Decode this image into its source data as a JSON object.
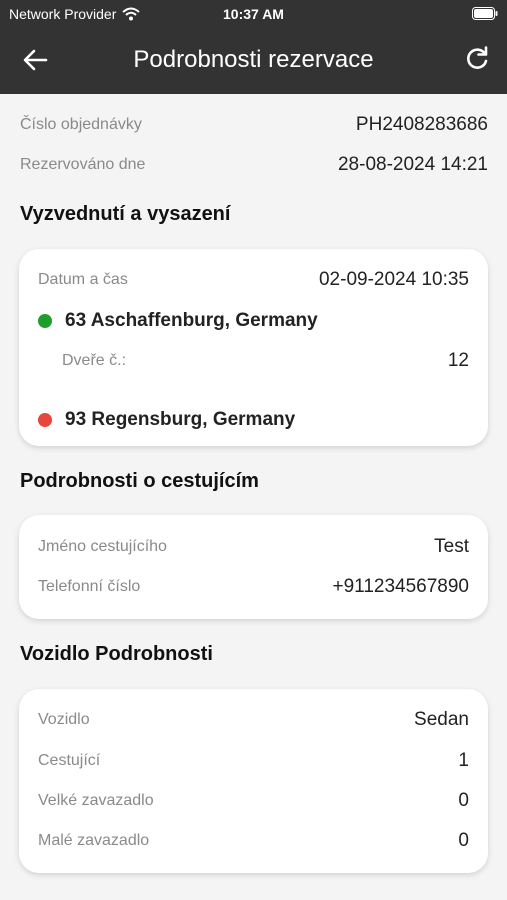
{
  "status_bar": {
    "carrier": "Network Provider",
    "time": "10:37 AM"
  },
  "header": {
    "title": "Podrobnosti rezervace"
  },
  "order": {
    "number_label": "Číslo objednávky",
    "number_value": "PH2408283686",
    "booked_label": "Rezervováno dne",
    "booked_value": "28-08-2024 14:21"
  },
  "pickup_section": {
    "title": "Vyzvednutí a vysazení",
    "datetime_label": "Datum a čas",
    "datetime_value": "02-09-2024 10:35",
    "pickup_location": "63 Aschaffenburg, Germany",
    "door_label": "Dveře č.:",
    "door_value": "12",
    "dropoff_location": "93 Regensburg, Germany",
    "pickup_dot_color": "#1f9e2c",
    "dropoff_dot_color": "#e8453c"
  },
  "passenger_section": {
    "title": "Podrobnosti o cestujícím",
    "name_label": "Jméno cestujícího",
    "name_value": "Test",
    "phone_label": "Telefonní číslo",
    "phone_value": "+911234567890"
  },
  "vehicle_section": {
    "title": "Vozidlo Podrobnosti",
    "vehicle_label": "Vozidlo",
    "vehicle_value": "Sedan",
    "passengers_label": "Cestující",
    "passengers_value": "1",
    "large_luggage_label": "Velké zavazadlo",
    "large_luggage_value": "0",
    "small_luggage_label": "Malé zavazadlo",
    "small_luggage_value": "0"
  }
}
